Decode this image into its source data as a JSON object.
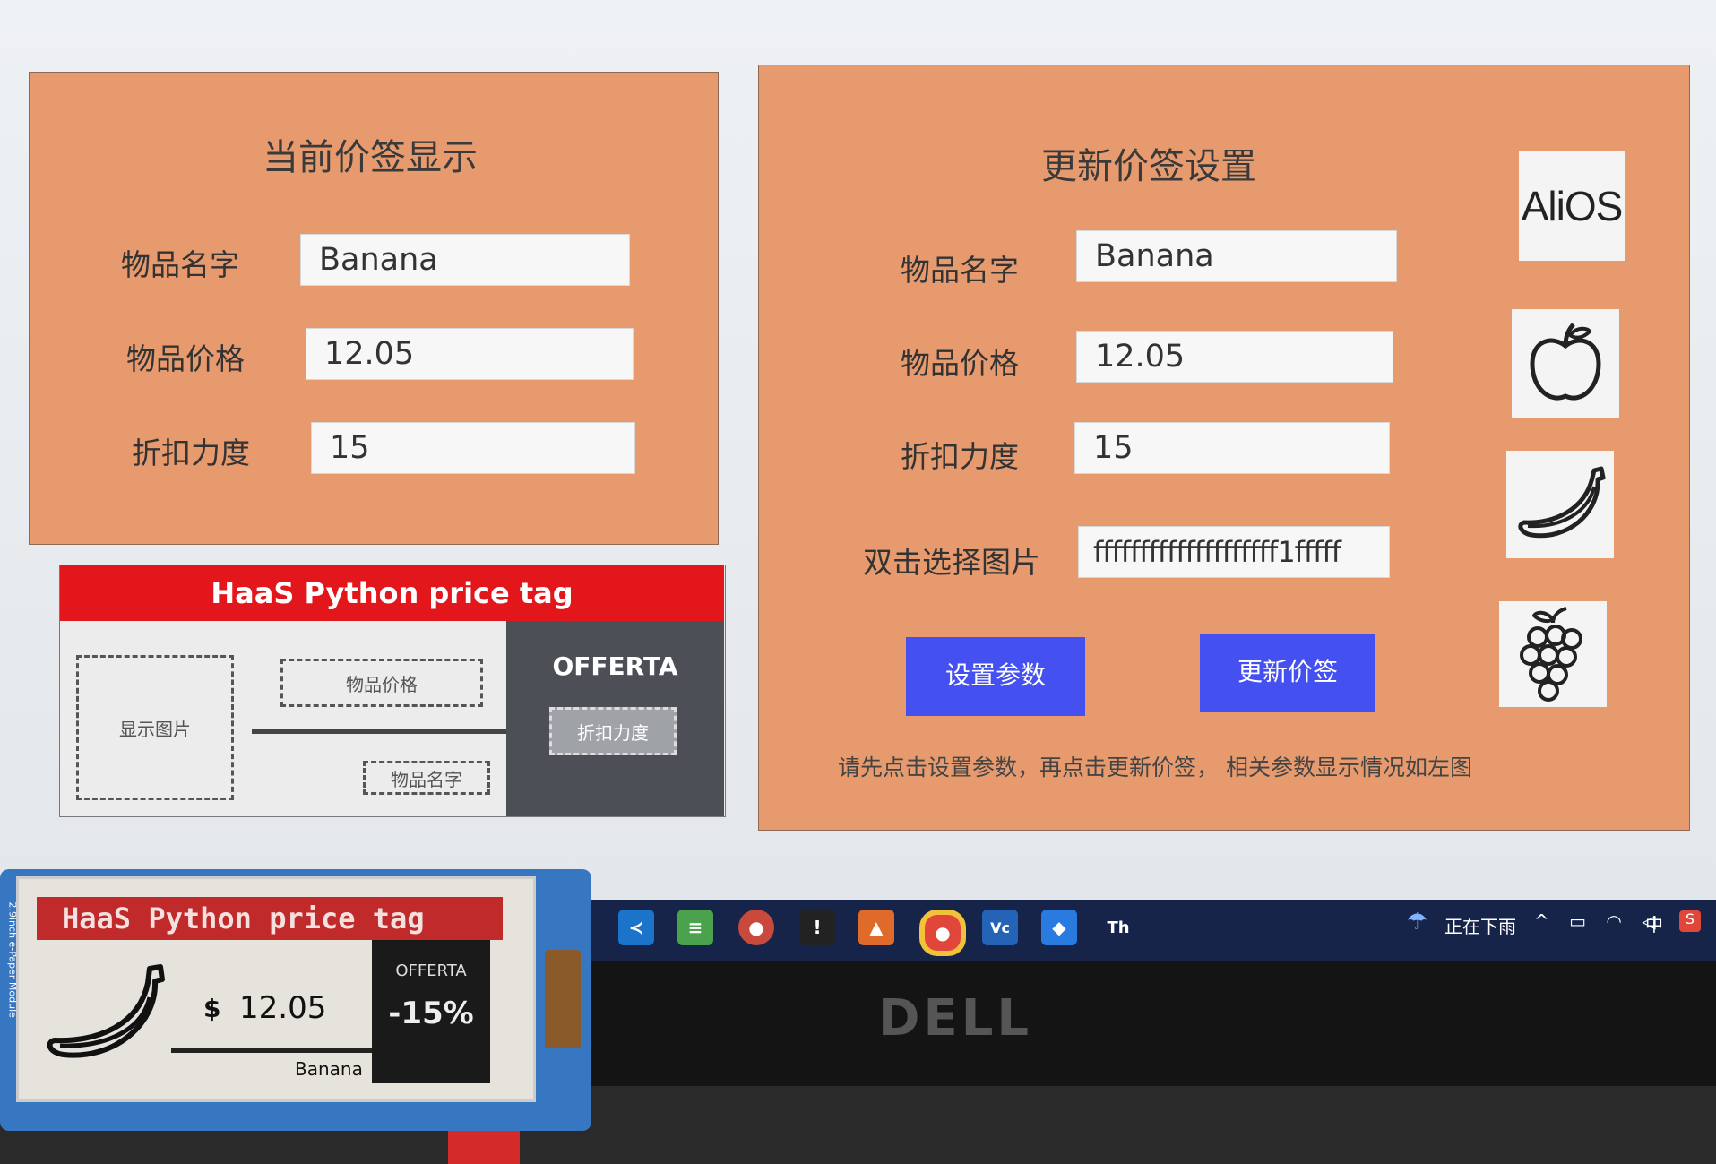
{
  "left_panel": {
    "title": "当前价签显示",
    "fields": [
      {
        "label": "物品名字",
        "value": "Banana"
      },
      {
        "label": "物品价格",
        "value": "12.05"
      },
      {
        "label": "折扣力度",
        "value": "15"
      }
    ]
  },
  "preview": {
    "header": "HaaS Python price tag",
    "image_placeholder": "显示图片",
    "price_placeholder": "物品价格",
    "name_placeholder": "物品名字",
    "offer_label": "OFFERTA",
    "discount_placeholder": "折扣力度"
  },
  "right_panel": {
    "title": "更新价签设置",
    "fields": [
      {
        "label": "物品名字",
        "value": "Banana"
      },
      {
        "label": "物品价格",
        "value": "12.05"
      },
      {
        "label": "折扣力度",
        "value": "15"
      },
      {
        "label": "双击选择图片",
        "value": "ffffffffffffffffffff1fffff"
      }
    ],
    "set_button": "设置参数",
    "update_button": "更新价签",
    "hint": "请先点击设置参数，再点击更新价签， 相关参数显示情况如左图",
    "logo_text": "AliOS"
  },
  "taskbar": {
    "weather_text": "正在下雨",
    "ime": "中"
  },
  "epaper": {
    "header": "HaaS Python price tag",
    "currency": "$",
    "price": "12.05",
    "name": "Banana",
    "offer_label": "OFFERTA",
    "discount": "-15%",
    "side_label": "2.9inch e-Paper Module"
  },
  "laptop": {
    "brand": "DELL"
  },
  "colors": {
    "panel": "#e69a6e",
    "button": "#4450f0",
    "header_red": "#e3161b",
    "offer_bg": "#4c4f55"
  }
}
